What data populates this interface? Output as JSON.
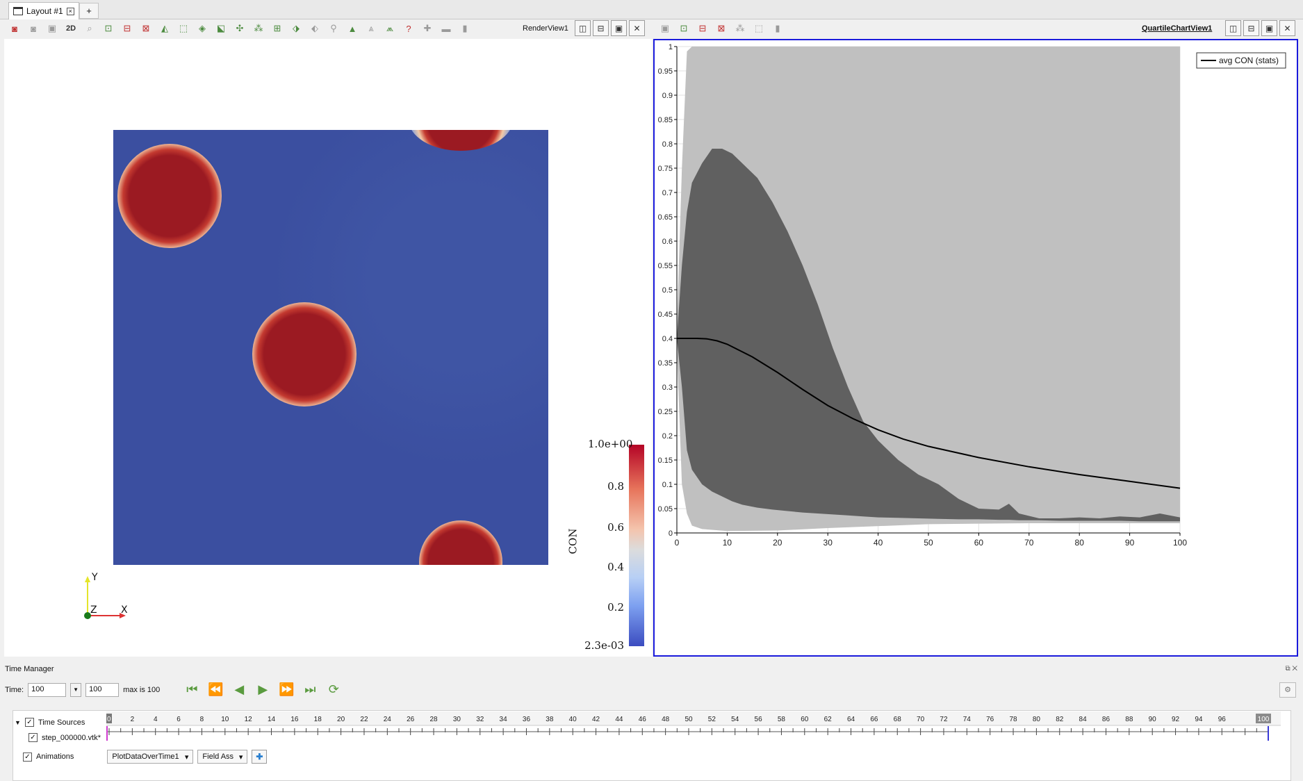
{
  "tabs": {
    "layout_label": "Layout #1",
    "add_label": "+"
  },
  "render_view": {
    "title": "RenderView1",
    "toolbar_2d": "2D",
    "colorbar": {
      "title": "CON",
      "ticks": [
        "1.0e+00",
        "0.8",
        "0.6",
        "0.4",
        "0.2",
        "2.3e-03"
      ]
    },
    "axes": {
      "y": "Y",
      "z": "Z",
      "x": "X"
    }
  },
  "chart_view": {
    "title": "QuartileChartView1"
  },
  "chart_data": {
    "type": "area",
    "legend": "avg CON (stats)",
    "legend_position": "top-right",
    "xlim": [
      0,
      100
    ],
    "ylim": [
      0,
      1
    ],
    "x_ticks": [
      0,
      10,
      20,
      30,
      40,
      50,
      60,
      70,
      80,
      90,
      100
    ],
    "y_ticks": [
      "0",
      "0.05",
      "0.1",
      "0.15",
      "0.2",
      "0.25",
      "0.3",
      "0.35",
      "0.4",
      "0.45",
      "0.5",
      "0.55",
      "0.6",
      "0.65",
      "0.7",
      "0.75",
      "0.8",
      "0.85",
      "0.9",
      "0.95",
      "1"
    ],
    "grid": true,
    "series": [
      {
        "name": "avg CON (stats)",
        "x": [
          0,
          2,
          4,
          6,
          8,
          10,
          15,
          20,
          25,
          30,
          35,
          40,
          45,
          50,
          60,
          70,
          80,
          90,
          100
        ],
        "values": [
          0.4,
          0.4,
          0.4,
          0.399,
          0.395,
          0.388,
          0.362,
          0.33,
          0.295,
          0.262,
          0.235,
          0.212,
          0.193,
          0.178,
          0.155,
          0.136,
          0.12,
          0.106,
          0.092
        ]
      }
    ],
    "minmax_band": {
      "x": [
        0,
        1,
        2,
        3,
        5,
        10,
        20,
        30,
        50,
        70,
        100
      ],
      "upper": [
        0.42,
        0.75,
        0.99,
        1.0,
        1.0,
        1.0,
        1.0,
        1.0,
        1.0,
        1.0,
        1.0
      ],
      "lower": [
        0.38,
        0.1,
        0.04,
        0.015,
        0.008,
        0.004,
        0.005,
        0.01,
        0.018,
        0.02,
        0.02
      ]
    },
    "quartile_band": {
      "x": [
        0,
        1,
        2,
        3,
        5,
        7,
        9,
        11,
        13,
        16,
        19,
        22,
        25,
        28,
        31,
        34,
        37,
        40,
        44,
        48,
        52,
        56,
        60,
        64,
        66,
        68,
        72,
        76,
        80,
        84,
        88,
        92,
        96,
        100
      ],
      "upper": [
        0.4,
        0.55,
        0.66,
        0.72,
        0.76,
        0.79,
        0.79,
        0.78,
        0.76,
        0.73,
        0.68,
        0.62,
        0.55,
        0.47,
        0.38,
        0.3,
        0.23,
        0.19,
        0.15,
        0.12,
        0.1,
        0.07,
        0.05,
        0.048,
        0.06,
        0.04,
        0.03,
        0.03,
        0.032,
        0.03,
        0.034,
        0.032,
        0.04,
        0.032
      ],
      "lower": [
        0.4,
        0.3,
        0.17,
        0.13,
        0.1,
        0.085,
        0.075,
        0.065,
        0.058,
        0.052,
        0.048,
        0.045,
        0.042,
        0.04,
        0.038,
        0.036,
        0.034,
        0.032,
        0.031,
        0.03,
        0.029,
        0.028,
        0.028,
        0.027,
        0.027,
        0.026,
        0.026,
        0.025,
        0.025,
        0.025,
        0.025,
        0.024,
        0.024,
        0.024
      ]
    }
  },
  "time_manager": {
    "title": "Time Manager",
    "time_label": "Time:",
    "time_value": "100",
    "step_value": "100",
    "max_label": "max is 100",
    "time_sources_label": "Time Sources",
    "source_file": "step_000000.vtk*",
    "animations_label": "Animations",
    "anim_source": "PlotDataOverTime1",
    "anim_property": "Field Ass",
    "scale_start": "0",
    "scale_end": "100",
    "scale_labels": [
      "2",
      "4",
      "6",
      "8",
      "10",
      "12",
      "14",
      "16",
      "18",
      "20",
      "22",
      "24",
      "26",
      "28",
      "30",
      "32",
      "34",
      "36",
      "38",
      "40",
      "42",
      "44",
      "46",
      "48",
      "50",
      "52",
      "54",
      "56",
      "58",
      "60",
      "62",
      "64",
      "66",
      "68",
      "70",
      "72",
      "74",
      "76",
      "78",
      "80",
      "82",
      "84",
      "86",
      "88",
      "90",
      "92",
      "94",
      "96"
    ]
  }
}
